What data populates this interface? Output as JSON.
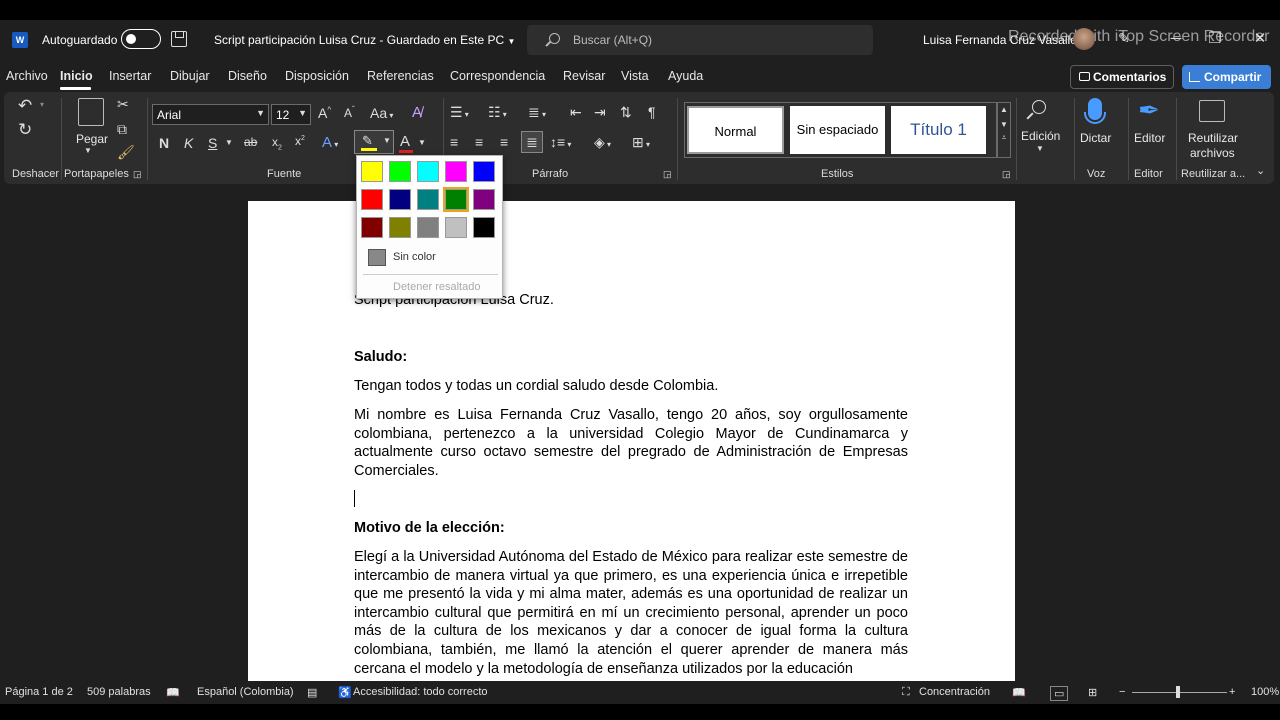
{
  "titlebar": {
    "autosave_label": "Autoguardado",
    "doc_title": "Script participación Luisa Cruz  -  Guardado en Este PC",
    "search_placeholder": "Buscar (Alt+Q)",
    "user_name": "Luisa Fernanda Cruz Vasallo",
    "watermark": "Recorded with iTop Screen Recorder"
  },
  "menu": {
    "tabs": [
      "Archivo",
      "Inicio",
      "Insertar",
      "Dibujar",
      "Diseño",
      "Disposición",
      "Referencias",
      "Correspondencia",
      "Revisar",
      "Vista",
      "Ayuda"
    ],
    "comentarios": "Comentarios",
    "compartir": "Compartir"
  },
  "ribbon": {
    "groups": {
      "deshacer": "Deshacer",
      "portapapeles": "Portapapeles",
      "fuente": "Fuente",
      "parrafo": "Párrafo",
      "estilos": "Estilos",
      "voz": "Voz",
      "editor": "Editor",
      "reutilizar": "Reutilizar a..."
    },
    "pegar": "Pegar",
    "font_name": "Arial",
    "font_size": "12",
    "styles": [
      "Normal",
      "Sin espaciado",
      "Título 1"
    ],
    "edicion": "Edición",
    "dictar": "Dictar",
    "editor_btn": "Editor",
    "reutilizar_line1": "Reutilizar",
    "reutilizar_line2": "archivos"
  },
  "color_popup": {
    "colors": [
      "#ffff00",
      "#00ff00",
      "#00ffff",
      "#ff00ff",
      "#0000ff",
      "#ff0000",
      "#000080",
      "#008080",
      "#008000",
      "#800080",
      "#800000",
      "#808000",
      "#808080",
      "#c0c0c0",
      "#000000"
    ],
    "selected_color": "#008000",
    "sin_color": "Sin color",
    "detener": "Detener resaltado"
  },
  "document": {
    "title_line": "Script participación Luisa Cruz.",
    "saludo_heading": "Saludo:",
    "saludo_p1": "Tengan todos y todas un cordial saludo desde Colombia.",
    "saludo_p2": "Mi nombre es Luisa Fernanda Cruz Vasallo, tengo 20 años, soy orgullosamente colombiana, pertenezco a la universidad Colegio Mayor de Cundinamarca y actualmente curso octavo semestre del pregrado de Administración de Empresas Comerciales.",
    "motivo_heading": "Motivo de la elección:",
    "motivo_p1": "Elegí a la Universidad Autónoma del Estado de México para realizar este semestre de intercambio de manera virtual ya que primero, es una experiencia única e irrepetible que me presentó la vida y mi alma mater, además es una oportunidad de realizar un intercambio cultural que permitirá en mí un crecimiento personal, aprender un poco más de la cultura de los mexicanos y dar a conocer de igual forma la cultura colombiana, también, me llamó la atención el querer aprender de manera más cercana el modelo y la metodología de enseñanza utilizados por la educación"
  },
  "status": {
    "page": "Página 1 de 2",
    "words": "509 palabras",
    "language": "Español (Colombia)",
    "accessibility": "Accesibilidad: todo correcto",
    "focus": "Concentración",
    "zoom": "100%"
  }
}
